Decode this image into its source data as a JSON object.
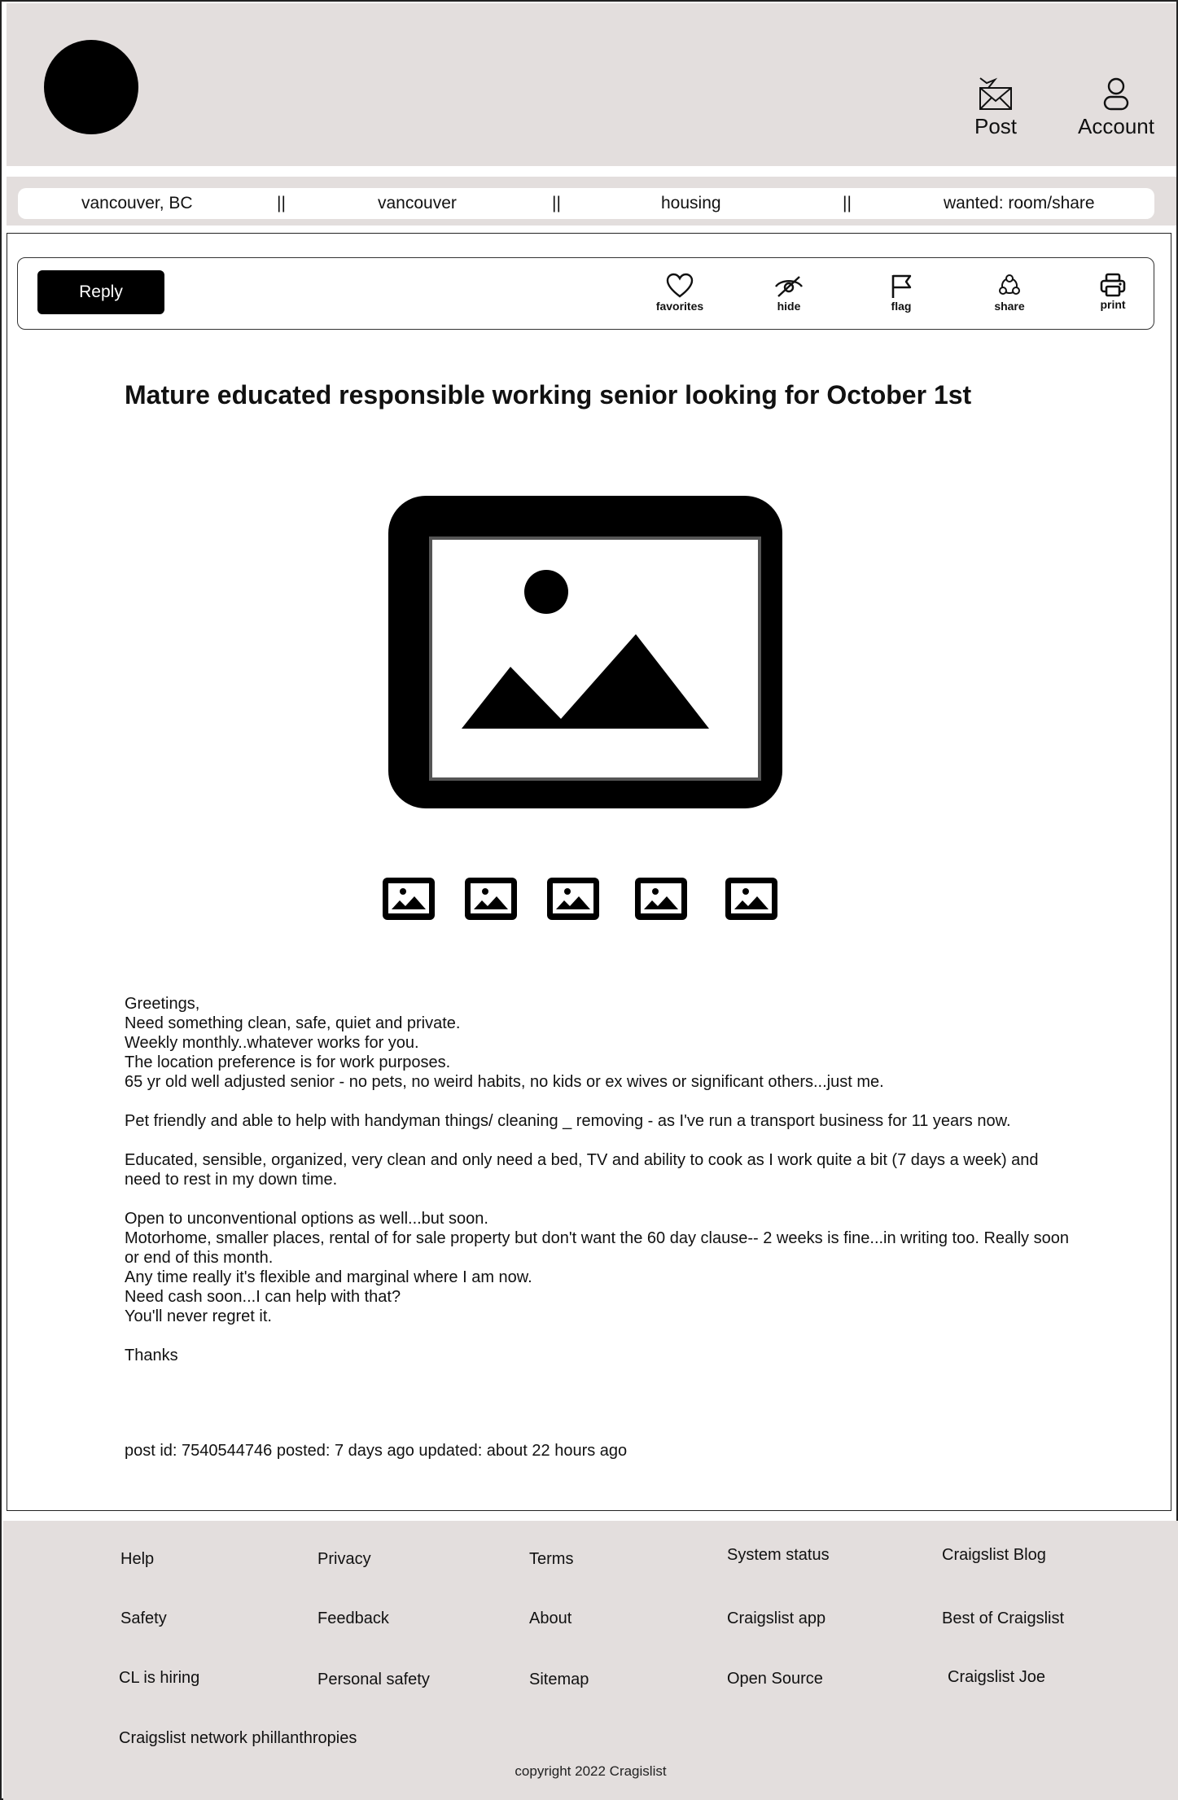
{
  "header": {
    "post_label": "Post",
    "account_label": "Account"
  },
  "breadcrumb": {
    "items": [
      "vancouver, BC",
      "vancouver",
      "housing",
      "wanted: room/share"
    ],
    "separator": "||"
  },
  "toolbar": {
    "reply_label": "Reply",
    "actions": [
      "favorites",
      "hide",
      "flag",
      "share",
      "print"
    ]
  },
  "post": {
    "title": "Mature educated responsible working senior looking for October 1st",
    "body": [
      "Greetings,\nNeed something clean, safe, quiet and private.\nWeekly monthly..whatever works for you.\nThe location preference is for work purposes.\n65 yr old well adjusted senior - no pets, no weird habits, no kids or ex wives or significant others...just me.",
      "Pet friendly and able to help with handyman things/ cleaning _ removing - as I've run a transport business for 11 years now.",
      "Educated, sensible, organized, very clean and only need a bed, TV and ability to cook as I work quite a bit (7 days a week) and need to rest in my down time.",
      "Open to unconventional options as well...but soon.\nMotorhome, smaller places, rental of for sale property but don't want the 60 day clause-- 2 weeks is fine...in writing too. Really soon or end of this month.\nAny time really it's flexible and marginal where I am now.\nNeed cash soon...I can help with that?\nYou'll never regret it.",
      "Thanks"
    ],
    "meta": "post id: 7540544746 posted: 7 days ago updated: about 22 hours ago"
  },
  "footer": {
    "links": {
      "help": "Help",
      "privacy": "Privacy",
      "terms": "Terms",
      "system_status": "System status",
      "blog": "Craigslist Blog",
      "safety": "Safety",
      "feedback": "Feedback",
      "about": "About",
      "app": "Craigslist app",
      "best_of": "Best of Craigslist",
      "hiring": "CL is hiring",
      "personal_safety": "Personal safety",
      "sitemap": "Sitemap",
      "open_source": "Open Source",
      "joe": "Craigslist Joe",
      "philanthropies": "Craigslist network phillanthropies"
    },
    "copyright": "copyright 2022 Cragislist"
  },
  "colors": {
    "header_bg": "#e3dedd",
    "accent": "#000000"
  }
}
